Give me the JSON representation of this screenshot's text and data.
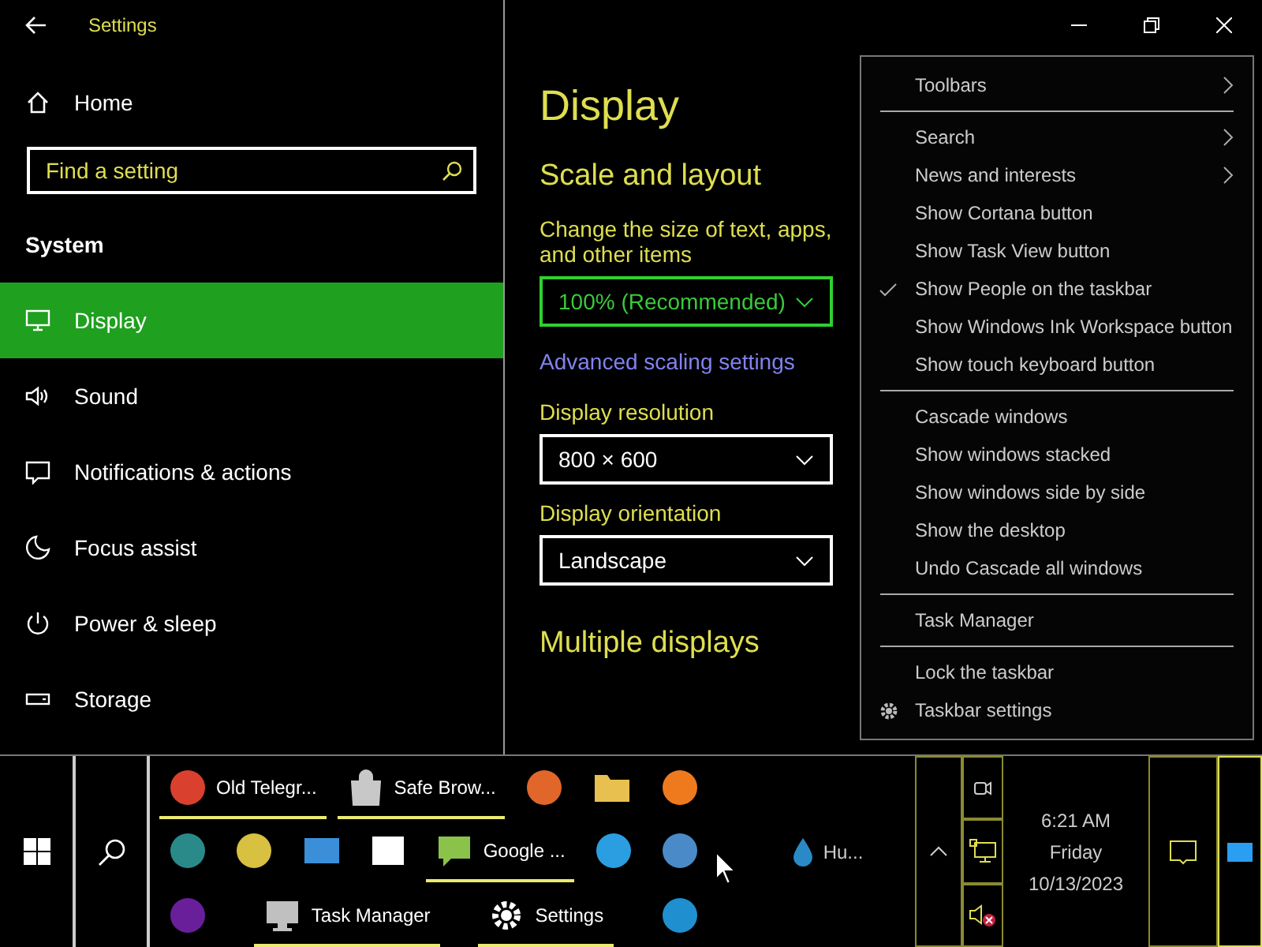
{
  "window": {
    "title": "Settings"
  },
  "sidebar": {
    "home": "Home",
    "search": {
      "placeholder": "Find a setting"
    },
    "section": "System",
    "items": [
      {
        "kind": "display",
        "label": "Display",
        "selected": true
      },
      {
        "kind": "sound",
        "label": "Sound",
        "selected": false
      },
      {
        "kind": "notifications",
        "label": "Notifications & actions",
        "selected": false
      },
      {
        "kind": "focus",
        "label": "Focus assist",
        "selected": false
      },
      {
        "kind": "power",
        "label": "Power & sleep",
        "selected": false
      },
      {
        "kind": "storage",
        "label": "Storage",
        "selected": false
      }
    ]
  },
  "page": {
    "title": "Display",
    "content": [
      {
        "kind": "heading",
        "text": "Scale and layout"
      },
      {
        "kind": "label",
        "text": "Change the size of text, apps, and other items"
      },
      {
        "kind": "dropdown",
        "text": "100% (Recommended)",
        "focused": true
      },
      {
        "kind": "link",
        "text": "Advanced scaling settings"
      },
      {
        "kind": "label",
        "text": "Display resolution"
      },
      {
        "kind": "dropdown",
        "text": "800 × 600",
        "focused": false
      },
      {
        "kind": "label",
        "text": "Display orientation"
      },
      {
        "kind": "dropdown",
        "text": "Landscape",
        "focused": false
      },
      {
        "kind": "heading",
        "text": "Multiple displays"
      }
    ]
  },
  "context_menu": {
    "items": [
      {
        "kind": "submenu",
        "label": "Toolbars"
      },
      {
        "kind": "separator"
      },
      {
        "kind": "submenu",
        "label": "Search"
      },
      {
        "kind": "submenu",
        "label": "News and interests"
      },
      {
        "kind": "toggle",
        "label": "Show Cortana button",
        "checked": false
      },
      {
        "kind": "toggle",
        "label": "Show Task View button",
        "checked": false
      },
      {
        "kind": "toggle",
        "label": "Show People on the taskbar",
        "checked": true
      },
      {
        "kind": "toggle",
        "label": "Show Windows Ink Workspace button",
        "checked": false
      },
      {
        "kind": "toggle",
        "label": "Show touch keyboard button",
        "checked": false
      },
      {
        "kind": "separator"
      },
      {
        "kind": "command",
        "label": "Cascade windows"
      },
      {
        "kind": "command",
        "label": "Show windows stacked"
      },
      {
        "kind": "command",
        "label": "Show windows side by side"
      },
      {
        "kind": "command",
        "label": "Show the desktop"
      },
      {
        "kind": "command",
        "label": "Undo Cascade all windows"
      },
      {
        "kind": "separator"
      },
      {
        "kind": "command",
        "label": "Task Manager"
      },
      {
        "kind": "separator"
      },
      {
        "kind": "toggle",
        "label": "Lock the taskbar",
        "checked": false
      },
      {
        "kind": "settings",
        "label": "Taskbar settings"
      }
    ]
  },
  "taskbar": {
    "rows": [
      [
        {
          "kind": "circle",
          "color": "#d9412e",
          "label": "Old Telegr...",
          "running": true
        },
        {
          "kind": "bag",
          "color": "#c8c8c8",
          "label": "Safe Brow...",
          "running": true
        },
        {
          "kind": "circle",
          "color": "#e0662a",
          "running": false
        },
        {
          "kind": "folder",
          "color": "#e8c050",
          "running": false
        },
        {
          "kind": "circle",
          "color": "#ef7a1e",
          "running": false
        }
      ],
      [
        {
          "kind": "circle",
          "color": "#2a8a8a",
          "running": false
        },
        {
          "kind": "circle",
          "color": "#d8c040",
          "running": false
        },
        {
          "kind": "card",
          "color": "#3a8fd8",
          "running": false
        },
        {
          "kind": "picture",
          "color": "#ffffff",
          "running": false
        },
        {
          "kind": "chat",
          "color": "#8bc34a",
          "label": "Google ...",
          "running": true
        },
        {
          "kind": "circle",
          "color": "#2a9ee0",
          "running": false
        },
        {
          "kind": "circle",
          "color": "#4a8ac8",
          "running": false
        }
      ],
      [
        {
          "kind": "circle",
          "color": "#6a1f9a",
          "running": false
        },
        {
          "kind": "monitor",
          "color": "#c0c0c0",
          "label": "Task Manager",
          "running": true
        },
        {
          "kind": "gear",
          "color": "#ffffff",
          "label": "Settings",
          "running": true
        },
        {
          "kind": "circle",
          "color": "#1f8fd0",
          "running": false
        }
      ]
    ],
    "weather": "Hu...",
    "clock": {
      "time": "6:21 AM",
      "day": "Friday",
      "date": "10/13/2023"
    }
  }
}
